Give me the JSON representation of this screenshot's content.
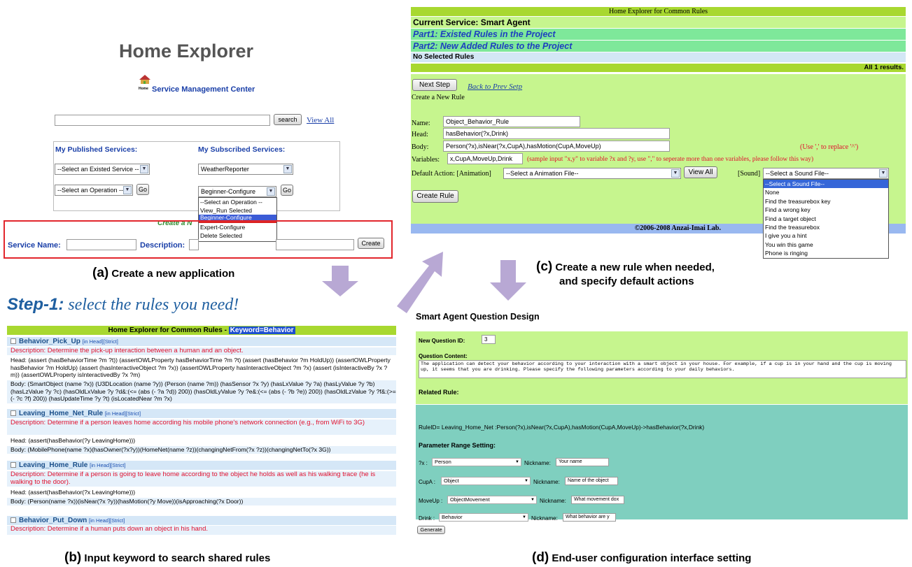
{
  "a": {
    "title": "Home Explorer",
    "logo_text": "Home",
    "subtitle": "Service Management Center",
    "search_btn": "search",
    "view_all": "View All",
    "published_label": "My Published Services:",
    "subscribed_label": "My Subscribed Services:",
    "sel_existed": "--Select an Existed Service --",
    "sel_operation": "--Select an Operation --",
    "go": "Go",
    "weather": "WeatherReporter",
    "beginner": "Beginner-Configure",
    "dropdown": [
      "--Select an Operation --",
      "View_Run Selected",
      "Beginner-Configure",
      "Expert-Configure",
      "Delete Selected"
    ],
    "create_new": "Create a N",
    "service_name_label": "Service Name:",
    "description_label": "Description:",
    "create_btn": "Create",
    "caption_letter": "(a)",
    "caption": " Create a new application"
  },
  "step": {
    "label": "Step-1:",
    "text": "select the rules you need!"
  },
  "b": {
    "header": "Home Explorer for Common Rules - ",
    "keyword": "Keyword=Behavior",
    "rules": [
      {
        "name": "Behavior_Pick_Up",
        "tags": "[in Head][Strict]",
        "desc": "Description: Determine the pick-up interaction between a human and an object.",
        "head": "Head: (assert (hasBehaviorTime ?m ?t)) (assertOWLProperty hasBehaviorTime ?m ?t) (assert (hasBehavior ?m HoldUp)) (assertOWLProperty hasBehavior ?m HoldUp) (assert (hasInteractiveObject ?m ?x)) (assertOWLProperty hasInteractiveObject ?m ?x) (assert (isInteractiveBy ?x ?m)) (assertOWLProperty isInteractivedBy ?x ?m)",
        "body": "Body: (SmartObject (name ?x)) (U3DLocation (name ?y)) (Person (name ?m)) (hasSensor ?x ?y) (hasLxValue ?y ?a) (hasLyValue ?y ?b) (hasLzValue ?y ?c) (hasOldLxValue ?y ?d&:(<= (abs (- ?a ?d)) 200)) (hasOldLyValue ?y ?e&:(<= (abs (- ?b ?e)) 200)) (hasOldLzValue ?y ?f&:(>= (- ?c ?f) 200)) (hasUpdateTime ?y ?t) (isLocatedNear ?m ?x)"
      },
      {
        "name": "Leaving_Home_Net_Rule",
        "tags": "[in Head][Strict]",
        "desc": "Description: Determine if a person leaves home according his mobile phone's network connection (e.g., from WiFi to 3G)",
        "head": "Head: (assert(hasBehavior(?y LeavingHome)))",
        "body": "Body: (MobilePhone(name ?x)(hasOwner(?x?y))(HomeNet(name ?z))(changingNetFrom(?x ?z))(changingNetTo(?x 3G))"
      },
      {
        "name": "Leaving_Home_Rule",
        "tags": "[in Head][Strict]",
        "desc": "Description: Determine if a person is going to leave home according to the object he holds as well as his walking trace (he is walking to the door).",
        "head": "Head: (assert(hasBehavior(?x LeavingHome)))",
        "body": "Body: (Person(name ?x))(isNear(?x ?y))(hasMotion(?y Move))(isApproaching(?x Door))"
      },
      {
        "name": "Behavior_Put_Down",
        "tags": "[in Head][Strict]",
        "desc": "Description: Determine if a human puts down an object in his hand."
      }
    ],
    "caption_letter": "(b)",
    "caption": " Input keyword to search shared rules"
  },
  "c": {
    "header": "Home Explorer for Common Rules",
    "current_service": "Current Service: Smart Agent",
    "part1": "Part1: Existed Rules in the Project",
    "part2": "Part2: New Added Rules to the Project",
    "no_selected": "No Selected Rules",
    "results": "All 1 results.",
    "next_step": "Next Step",
    "back": "Back to Prev Setp",
    "create_new_rule": "Create a New Rule",
    "name_label": "Name:",
    "name_value": "Object_Behavior_Rule",
    "head_label": "Head:",
    "head_value": "hasBehavior(?x,Drink)",
    "body_label": "Body:",
    "body_value": "Person(?x),isNear(?x,CupA),hasMotion(CupA,MoveUp)",
    "body_hint": "(Use ',' to replace '^')",
    "variables_label": "Variables:",
    "variables_value": "x,CupA,MoveUp,Drink",
    "variables_hint": "(sample input \"x,y\" to variable ?x and ?y, use \",\" to seperate more than one variables, please follow this way)",
    "default_action_label": "Default Action: [Animation]",
    "anim_select": "--Select a Animation File--",
    "view_all": "View All",
    "sound_label": "[Sound]",
    "sound_select": "--Select a Sound File--",
    "sound_options": [
      "--Select a Sound File--",
      "None",
      "Find the treasurebox key",
      "Find a wrong key",
      "Find a target object",
      "Find the treasurebox",
      "I give you a hint",
      "You win this game",
      "Phone is ringing"
    ],
    "create_rule": "Create Rule",
    "footer": "©2006-2008 Anzai-Imai Lab.",
    "caption_letter": "(c)",
    "caption1": " Create a new rule when needed,",
    "caption2": "and specify default actions"
  },
  "d": {
    "title": "Smart Agent Question Design",
    "new_q_label": "New Question ID:",
    "new_q_value": "3",
    "content_label": "Question Content:",
    "content_value": "The application can detect your behavior according to your interaction with a smart object in your house. For example, if a cup is in your hand and the cup is moving up, it seems that you are drinking. Please specify the following parameters according to your daily behaviors.",
    "related_label": "Related Rule:",
    "rule_text": "RuleID= Leaving_Home_Net :Person(?x),isNear(?x,CupA),hasMotion(CupA,MoveUp)->hasBehavior(?x,Drink)",
    "param_label": "Parameter Range Setting:",
    "params": [
      {
        "var": "?x :",
        "sel": "Person",
        "nick": "Nickname:",
        "val": "Your name"
      },
      {
        "var": "CupA :",
        "sel": "Object",
        "nick": "Nickname:",
        "val": "Name of the object"
      },
      {
        "var": "MoveUp :",
        "sel": "ObjectMovement",
        "nick": "Nickname:",
        "val": "What movement dox"
      },
      {
        "var": "Drink :",
        "sel": "Behavior",
        "nick": "Nickname:",
        "val": "What behavior are y"
      }
    ],
    "generate": "Generate",
    "caption_letter": "(d)",
    "caption": " End-user configuration interface setting"
  },
  "colors": {
    "lime": "#a8d830",
    "panel_c": "#c6f58e",
    "teal": "#7fcfbf",
    "red": "#e0102e",
    "blue_bar": "#1d4fd0"
  }
}
